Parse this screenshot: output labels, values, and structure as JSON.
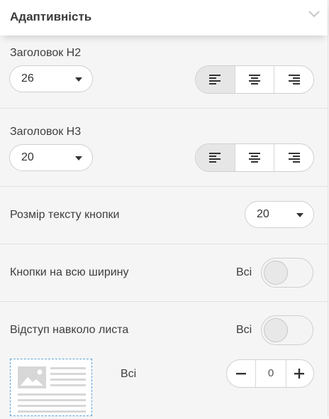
{
  "header": {
    "title": "Адаптивність",
    "collapse_icon": "chevron-down-icon"
  },
  "h2": {
    "label": "Заголовок H2",
    "size": "26",
    "alignment": "left"
  },
  "h3": {
    "label": "Заголовок H3",
    "size": "20",
    "alignment": "left"
  },
  "button_text": {
    "label": "Розмір тексту кнопки",
    "size": "20"
  },
  "full_width": {
    "label": "Кнопки на всю ширину",
    "scope": "Всі",
    "enabled": false
  },
  "sheet_padding": {
    "label": "Відступ навколо листа",
    "scope": "Всі",
    "enabled": false
  },
  "padding_value": {
    "scope": "Всі",
    "value": "0"
  },
  "colors": {
    "accent": "#5aa0d8",
    "active_segment": "#e6e6e6"
  }
}
